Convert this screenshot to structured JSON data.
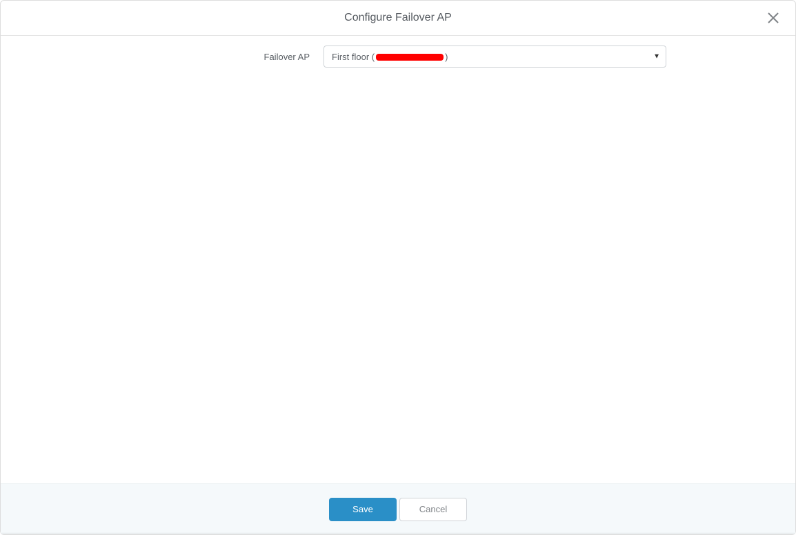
{
  "dialog": {
    "title": "Configure Failover AP"
  },
  "form": {
    "failover_label": "Failover AP",
    "failover_value_prefix": "First floor (",
    "failover_value_suffix": ")"
  },
  "footer": {
    "save_label": "Save",
    "cancel_label": "Cancel"
  },
  "icons": {
    "close": "close-icon",
    "dropdown_arrow": "▼"
  },
  "colors": {
    "primary_button": "#2a8fc7",
    "text": "#5b6066",
    "border": "#cfd3d7",
    "footer_bg": "#f5f9fb",
    "redaction": "#ff0000"
  }
}
